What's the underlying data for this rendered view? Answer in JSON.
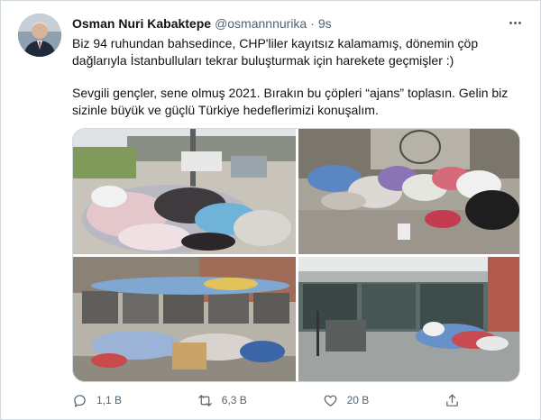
{
  "tweet": {
    "author_name": "Osman Nuri Kabaktepe",
    "handle": "@osmannnurika",
    "separator": "·",
    "time": "9s",
    "paragraphs": [
      "Biz 94 ruhundan bahsedince, CHP'liler kayıtsız kalamamış, dönemin çöp dağlarıyla İstanbulluları tekrar buluşturmak için harekete geçmişler :)",
      "Sevgili gençler, sene olmuş 2021. Bırakın bu çöpleri “ajans” toplasın. Gelin biz sizinle büyük ve güçlü Türkiye hedeflerimizi konuşalım."
    ],
    "media": [
      {
        "icon": "garbage-street-photo"
      },
      {
        "icon": "garbage-wall-photo"
      },
      {
        "icon": "garbage-containers-photo"
      },
      {
        "icon": "garbage-storefront-photo"
      }
    ]
  },
  "actions": {
    "reply": {
      "icon": "reply-icon",
      "count": "1,1 B"
    },
    "retweet": {
      "icon": "retweet-icon",
      "count": "6,3 B"
    },
    "like": {
      "icon": "heart-icon",
      "count": "20 B"
    },
    "share": {
      "icon": "share-icon"
    }
  },
  "colors": {
    "text": "#0f1419",
    "muted": "#536471",
    "border": "#cfd9de"
  }
}
